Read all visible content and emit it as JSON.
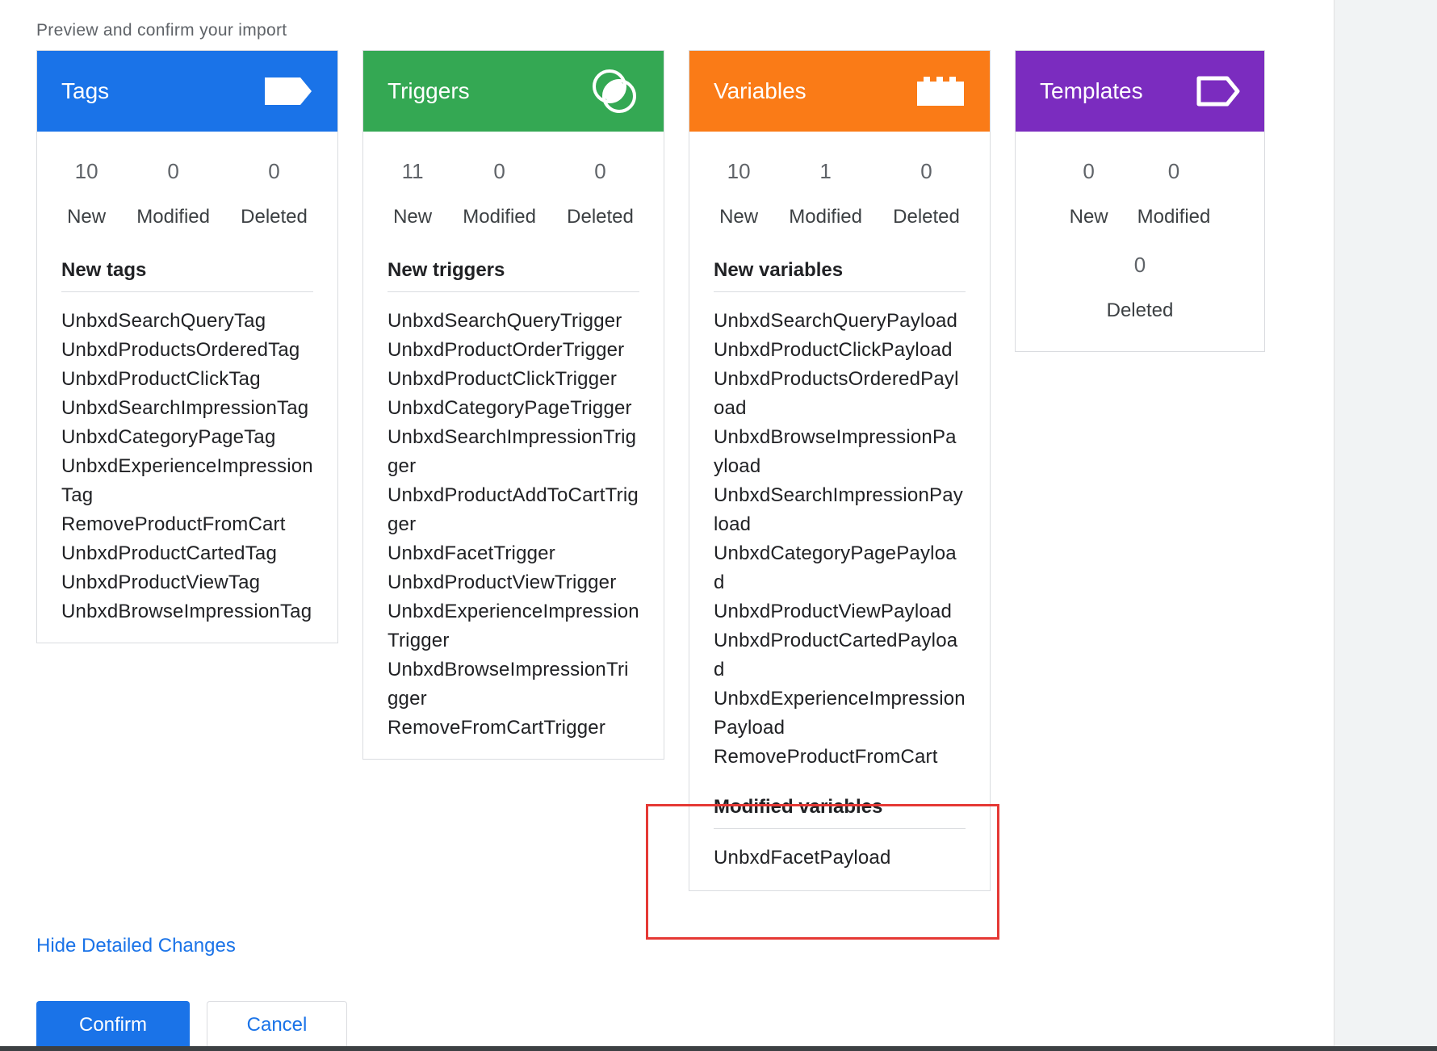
{
  "page": {
    "subtitle": "Preview and confirm your import"
  },
  "cards": {
    "tags": {
      "title": "Tags",
      "color": "#1a73e8",
      "counts": {
        "new": "10",
        "modified": "0",
        "deleted": "0"
      },
      "labels": {
        "new": "New",
        "modified": "Modified",
        "deleted": "Deleted"
      },
      "new_section_title": "New tags",
      "new_items": [
        "UnbxdSearchQueryTag",
        "UnbxdProductsOrderedTag",
        "UnbxdProductClickTag",
        "UnbxdSearchImpressionTag",
        "UnbxdCategoryPageTag",
        "UnbxdExperienceImpressionTag",
        "RemoveProductFromCart",
        "UnbxdProductCartedTag",
        "UnbxdProductViewTag",
        "UnbxdBrowseImpressionTag"
      ]
    },
    "triggers": {
      "title": "Triggers",
      "color": "#34a853",
      "counts": {
        "new": "11",
        "modified": "0",
        "deleted": "0"
      },
      "labels": {
        "new": "New",
        "modified": "Modified",
        "deleted": "Deleted"
      },
      "new_section_title": "New triggers",
      "new_items": [
        "UnbxdSearchQueryTrigger",
        "UnbxdProductOrderTrigger",
        "UnbxdProductClickTrigger",
        "UnbxdCategoryPageTrigger",
        "UnbxdSearchImpressionTrigger",
        "UnbxdProductAddToCartTrigger",
        "UnbxdFacetTrigger",
        "UnbxdProductViewTrigger",
        "UnbxdExperienceImpressionTrigger",
        "UnbxdBrowseImpressionTrigger",
        "RemoveFromCartTrigger"
      ]
    },
    "variables": {
      "title": "Variables",
      "color": "#fa7b17",
      "counts": {
        "new": "10",
        "modified": "1",
        "deleted": "0"
      },
      "labels": {
        "new": "New",
        "modified": "Modified",
        "deleted": "Deleted"
      },
      "new_section_title": "New variables",
      "new_items": [
        "UnbxdSearchQueryPayload",
        "UnbxdProductClickPayload",
        "UnbxdProductsOrderedPayload",
        "UnbxdBrowseImpressionPayload",
        "UnbxdSearchImpressionPayload",
        "UnbxdCategoryPagePayload",
        "UnbxdProductViewPayload",
        "UnbxdProductCartedPayload",
        "UnbxdExperienceImpressionPayload",
        "RemoveProductFromCart"
      ],
      "modified_section_title": "Modified variables",
      "modified_items": [
        "UnbxdFacetPayload"
      ]
    },
    "templates": {
      "title": "Templates",
      "color": "#7b2cbf",
      "counts": {
        "new": "0",
        "modified": "0",
        "deleted": "0"
      },
      "labels": {
        "new": "New",
        "modified": "Modified",
        "deleted": "Deleted"
      }
    }
  },
  "actions": {
    "hide_details": "Hide Detailed Changes",
    "confirm": "Confirm",
    "cancel": "Cancel"
  },
  "icons": {
    "tags": "tag-icon",
    "triggers": "trigger-icon",
    "variables": "variable-block-icon",
    "templates": "template-tag-outline-icon"
  }
}
